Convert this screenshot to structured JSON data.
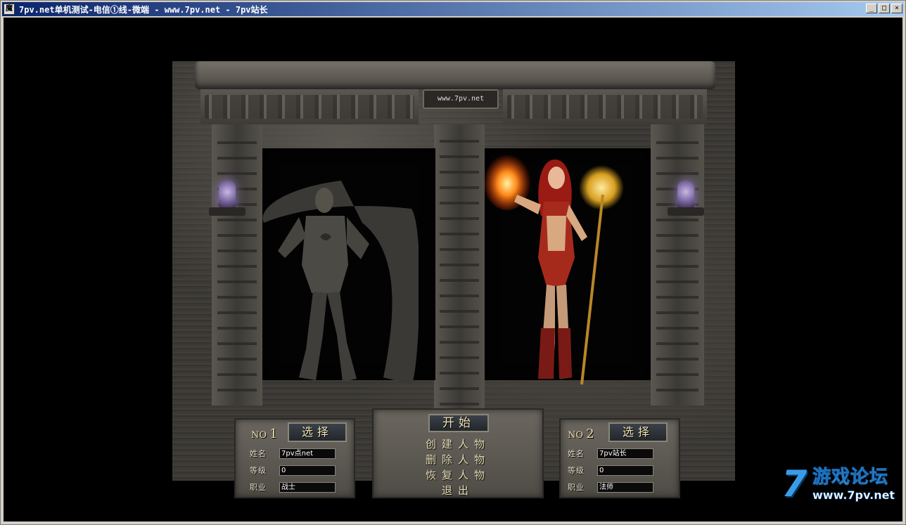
{
  "window": {
    "title": "7pv.net单机测试-电信①线-微端",
    "title_suffix": "- www.7pv.net - 7pv站长",
    "icon_glyph": "魔",
    "controls": {
      "minimize": "_",
      "maximize": "□",
      "close": "×"
    }
  },
  "scene": {
    "sign_text": "www.7pv.net"
  },
  "slot1": {
    "no_label": "NO",
    "no_value": "1",
    "select_label": "选择",
    "name_label": "姓名",
    "name_value": "7pv点net",
    "level_label": "等级",
    "level_value": "0",
    "class_label": "职业",
    "class_value": "战士"
  },
  "slot2": {
    "no_label": "NO",
    "no_value": "2",
    "select_label": "选择",
    "name_label": "姓名",
    "name_value": "7pv站长",
    "level_label": "等级",
    "level_value": "0",
    "class_label": "职业",
    "class_value": "法师"
  },
  "menu": {
    "start": "开始",
    "create": "创建人物",
    "delete": "删除人物",
    "restore": "恢复人物",
    "exit": "退出"
  },
  "watermark": {
    "seven": "7",
    "name": "游戏论坛",
    "url": "www.7pv.net",
    "color": "#3a9ce8"
  }
}
